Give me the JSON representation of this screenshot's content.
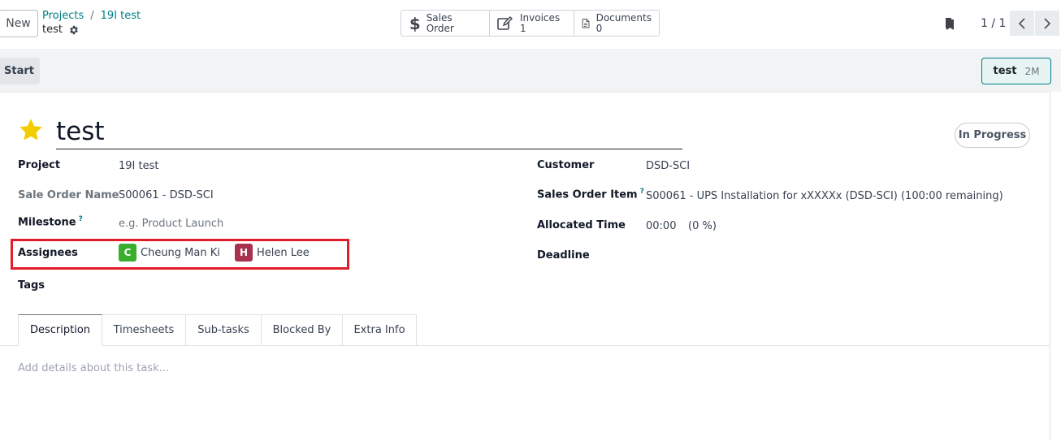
{
  "controlPanel": {
    "new_label": "New",
    "breadcrumb": [
      "Projects",
      "19I test"
    ],
    "breadcrumb_sep": "/",
    "record_name": "test"
  },
  "smartButtons": {
    "sales_order_label": "Sales Order",
    "invoices_label": "Invoices",
    "invoices_count": "1",
    "documents_label": "Documents",
    "documents_count": "0"
  },
  "pager": {
    "value": "1 / 1"
  },
  "statusbar": {
    "start_label": "Start",
    "stage_name": "test",
    "stage_time": "2M"
  },
  "task": {
    "title": "test",
    "state": "In Progress",
    "favorite": true
  },
  "fields": {
    "project_label": "Project",
    "project_value": "19I test",
    "sale_order_name_label": "Sale Order Name",
    "sale_order_name_value": "S00061 - DSD-SCI",
    "milestone_label": "Milestone",
    "milestone_help": "?",
    "milestone_placeholder": "e.g. Product Launch",
    "assignees_label": "Assignees",
    "assignees": [
      {
        "initial": "C",
        "name": "Cheung Man Ki",
        "color": "#3aad2e"
      },
      {
        "initial": "H",
        "name": "Helen Lee",
        "color": "#a8324e"
      }
    ],
    "tags_label": "Tags",
    "customer_label": "Customer",
    "customer_value": "DSD-SCI",
    "sales_order_item_label": "Sales Order Item",
    "sales_order_item_help": "?",
    "sales_order_item_value": "S00061 - UPS Installation for xXXXXx (DSD-SCI) (100:00 remaining)",
    "allocated_time_label": "Allocated Time",
    "allocated_time_value": "00:00",
    "allocated_time_percent": "(0 %)",
    "deadline_label": "Deadline"
  },
  "tabs": [
    "Description",
    "Timesheets",
    "Sub-tasks",
    "Blocked By",
    "Extra Info"
  ],
  "description_placeholder": "Add details about this task...",
  "colors": {
    "accent": "#017e84",
    "star": "#f3cc00",
    "highlight_box": "#e11d2a"
  }
}
